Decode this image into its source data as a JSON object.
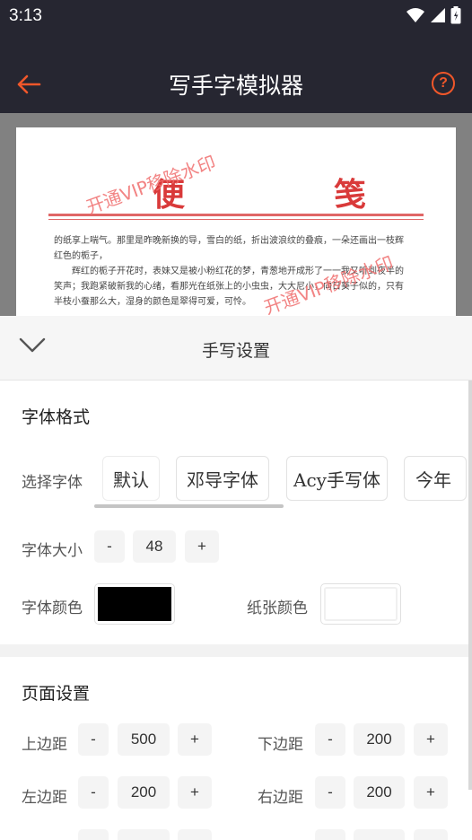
{
  "status_bar": {
    "time": "3:13"
  },
  "app_bar": {
    "title": "写手字模拟器",
    "help_icon": "?"
  },
  "paper": {
    "title_chars": [
      "便",
      "笺"
    ],
    "paragraphs": [
      "的纸享上喘气。那里是昨晚新换的导，雪白的纸，折出波浪纹的叠痕，一朵还画出一枝辉红色的栀子，",
      "辉红的栀子开花时，表妹又是被小粉红花的梦，青葱地开成形了一一我又听到夜半的笑声；我跑紧破新我的心绪，看那光在纸张上的小虫虫，大大尼小，向日葵子似的，只有半枝小蚕那么大，湿身的颜色是翠得可爱，可怜。"
    ],
    "watermark": "开通VIP移除水印"
  },
  "sheet": {
    "title": "手写设置",
    "font_format": {
      "section_title": "字体格式",
      "choose_font_label": "选择字体",
      "fonts": [
        "默认",
        "邓导字体",
        "Acy手写体",
        "今年"
      ],
      "font_size_label": "字体大小",
      "font_size_value": "48",
      "minus": "-",
      "plus": "+",
      "font_color_label": "字体颜色",
      "paper_color_label": "纸张颜色",
      "font_color": "#000000",
      "paper_color": "#ffffff"
    },
    "page_settings": {
      "section_title": "页面设置",
      "top_margin_label": "上边距",
      "top_margin_value": "500",
      "bottom_margin_label": "下边距",
      "bottom_margin_value": "200",
      "left_margin_label": "左边距",
      "left_margin_value": "200",
      "right_margin_label": "右边距",
      "right_margin_value": "200",
      "minus": "-",
      "plus": "+"
    }
  },
  "colors": {
    "accent": "#f0572a",
    "app_bar": "#262631",
    "watermark": "#f06e6e"
  }
}
